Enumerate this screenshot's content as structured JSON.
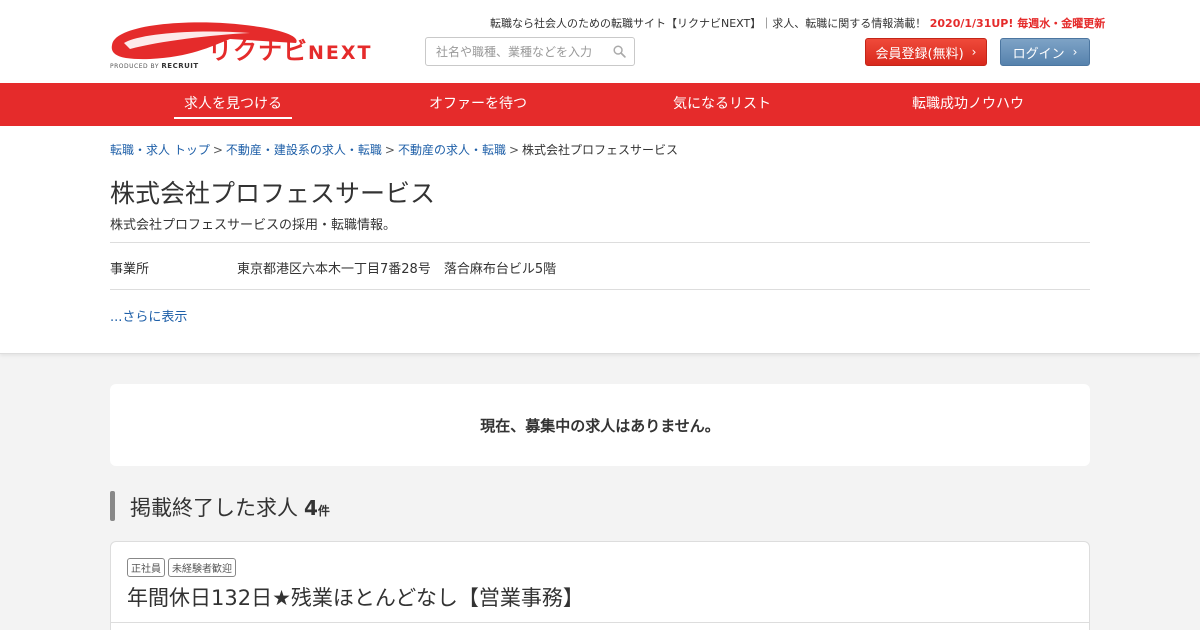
{
  "header": {
    "logo_text": "リクナビ",
    "logo_next": "NEXT",
    "produced_by": "PRODUCED BY",
    "produced_brand": "RECRUIT",
    "tagline": "転職なら社会人のための転職サイト【リクナビNEXT】｜求人、転職に関する情報満載！",
    "update_note": "2020/1/31UP! 毎週水・金曜更新",
    "search_placeholder": "社名や職種、業種などを入力",
    "register_label": "会員登録(無料)",
    "login_label": "ログイン",
    "brand_color": "#e52b2b"
  },
  "nav": {
    "items": [
      {
        "label": "求人を見つける",
        "active": true
      },
      {
        "label": "オファーを待つ",
        "active": false
      },
      {
        "label": "気になるリスト",
        "active": false
      },
      {
        "label": "転職成功ノウハウ",
        "active": false
      }
    ]
  },
  "breadcrumb": {
    "items": [
      "転職・求人 トップ",
      "不動産・建設系の求人・転職",
      "不動産の求人・転職"
    ],
    "separator": ">",
    "current": "株式会社プロフェスサービス"
  },
  "company": {
    "name": "株式会社プロフェスサービス",
    "subtitle": "株式会社プロフェスサービスの採用・転職情報。",
    "office_label": "事業所",
    "office_value": "東京都港区六本木一丁目7番28号　落合麻布台ビル5階",
    "more_link": "...さらに表示"
  },
  "notice": {
    "text": "現在、募集中の求人はありません。"
  },
  "ended": {
    "title": "掲載終了した求人",
    "count": "4",
    "unit": "件",
    "jobs": [
      {
        "tags": [
          "正社員",
          "未経験者歓迎"
        ],
        "title": "年間休日132日★残業ほとんどなし【営業事務】"
      }
    ]
  }
}
